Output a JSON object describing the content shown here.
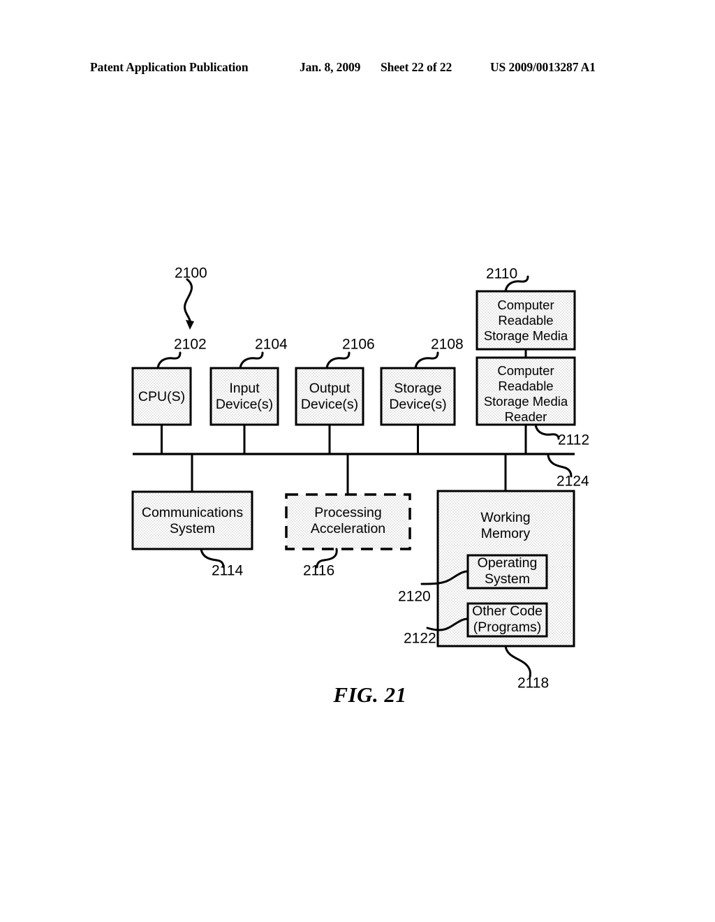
{
  "header": {
    "publication": "Patent Application Publication",
    "date": "Jan. 8, 2009",
    "sheet": "Sheet 22 of 22",
    "patent_number": "US 2009/0013287 A1"
  },
  "figure": {
    "caption": "FIG. 21",
    "system_ref": "2100"
  },
  "boxes": {
    "cpu": {
      "label": "CPU(S)",
      "ref": "2102"
    },
    "input_device": {
      "line1": "Input",
      "line2": "Device(s)",
      "ref": "2104"
    },
    "output_device": {
      "line1": "Output",
      "line2": "Device(s)",
      "ref": "2106"
    },
    "storage_device": {
      "line1": "Storage",
      "line2": "Device(s)",
      "ref": "2108"
    },
    "storage_media": {
      "line1": "Computer",
      "line2": "Readable",
      "line3": "Storage Media",
      "ref": "2110"
    },
    "storage_media_reader": {
      "line1": "Computer",
      "line2": "Readable",
      "line3": "Storage Media",
      "line4": "Reader",
      "ref": "2112"
    },
    "communications_system": {
      "line1": "Communications",
      "line2": "System",
      "ref": "2114"
    },
    "processing_acceleration": {
      "line1": "Processing",
      "line2": "Acceleration",
      "ref": "2116"
    },
    "working_memory": {
      "line1": "Working",
      "line2": "Memory",
      "ref": "2118"
    },
    "operating_system": {
      "line1": "Operating",
      "line2": "System",
      "ref": "2120"
    },
    "other_code": {
      "line1": "Other Code",
      "line2": "(Programs)",
      "ref": "2122"
    },
    "bus": {
      "ref": "2124"
    }
  },
  "colors": {
    "ink": "#000000",
    "paper": "#ffffff",
    "box_fill": "#f1f1f1"
  }
}
